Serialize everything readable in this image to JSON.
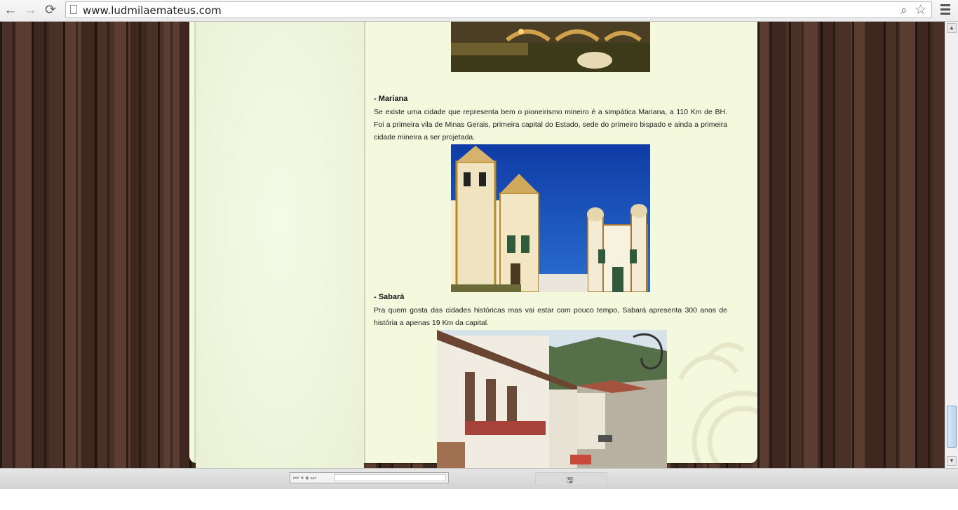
{
  "browser": {
    "url": "www.ludmilaemateus.com",
    "back_icon": "←",
    "forward_icon": "→",
    "reload_icon": "⟳",
    "zoom_icon": "⌕",
    "star_icon": "☆"
  },
  "article": {
    "mariana": {
      "heading": "- Mariana",
      "text": "Se existe uma cidade que representa bem o pioneirismo mineiro é a simpática Mariana, a 110 Km de BH. Foi a primeira vila de Minas Gerais, primeira capital do Estado, sede do primeiro bispado e ainda a primeira cidade mineira a ser projetada."
    },
    "sabara": {
      "heading": "- Sabará",
      "text": "Pra quem gosta das cidades históricas mas vai estar com pouco tempo, Sabará apresenta 300 anos de história a apenas 19 Km da capital."
    }
  },
  "player": {
    "controls": "⏮ ⏸ ⏹ ⏭"
  },
  "colors": {
    "panel": "#f4f8dc",
    "wood": "#4a3127"
  }
}
